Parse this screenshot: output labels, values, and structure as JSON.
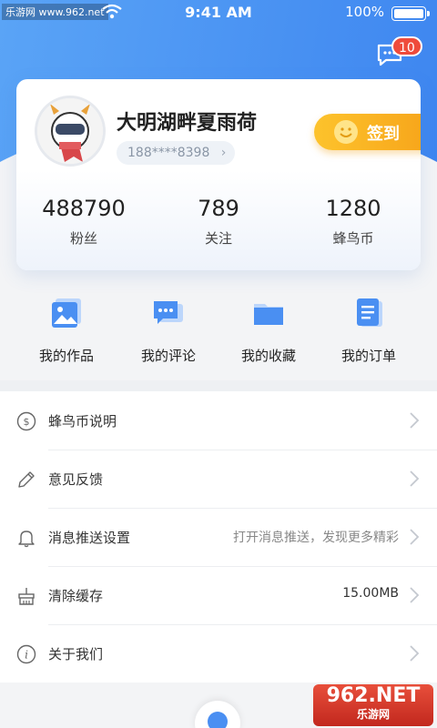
{
  "status_bar": {
    "carrier": "乐游网 www.962.net",
    "time": "9:41 AM",
    "battery_text": "100%"
  },
  "header": {
    "message_badge": "10"
  },
  "profile": {
    "nickname": "大明湖畔夏雨荷",
    "phone": "188****8398",
    "signin_label": "签到",
    "stats": [
      {
        "value": "488790",
        "label": "粉丝"
      },
      {
        "value": "789",
        "label": "关注"
      },
      {
        "value": "1280",
        "label": "蜂鸟币"
      }
    ]
  },
  "shortcuts": [
    {
      "label": "我的作品",
      "icon": "image-icon"
    },
    {
      "label": "我的评论",
      "icon": "comment-icon"
    },
    {
      "label": "我的收藏",
      "icon": "folder-icon"
    },
    {
      "label": "我的订单",
      "icon": "order-icon"
    }
  ],
  "menu": [
    {
      "label": "蜂鸟币说明",
      "value": "",
      "icon": "coin-icon"
    },
    {
      "label": "意见反馈",
      "value": "",
      "icon": "pencil-icon"
    },
    {
      "label": "消息推送设置",
      "value": "打开消息推送，发现更多精彩",
      "icon": "bell-icon"
    },
    {
      "label": "清除缓存",
      "value": "15.00MB",
      "icon": "broom-icon"
    },
    {
      "label": "关于我们",
      "value": "",
      "icon": "info-icon"
    }
  ],
  "watermark": {
    "brand_top": "962.NET",
    "brand_bottom": "乐游网"
  },
  "colors": {
    "accent_blue": "#3e86f0",
    "signin_orange": "#f7a41a",
    "badge_red": "#ef4b3b"
  }
}
